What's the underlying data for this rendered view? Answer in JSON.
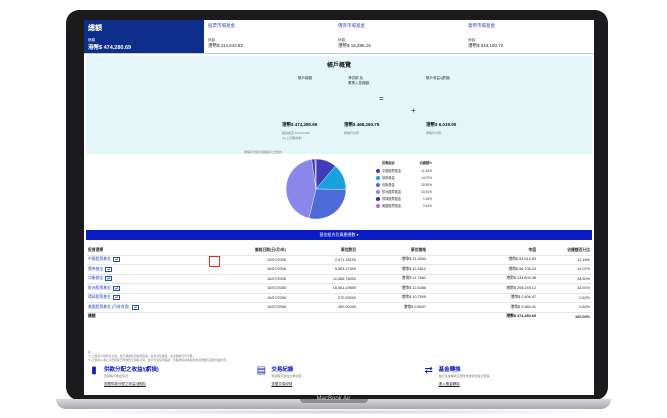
{
  "device": {
    "brand": "MacBook Air"
  },
  "summary": {
    "total": {
      "title": "總額",
      "label": "餘額",
      "value": "港幣$ 474,280.69"
    },
    "categories": [
      {
        "title": "股票市場基金",
        "label": "餘額",
        "value": "港幣$ 114,643.82"
      },
      {
        "title": "債券市場基金",
        "label": "餘額",
        "value": "港幣$ 16,286.15"
      },
      {
        "title": "貨幣市場基金",
        "label": "餘額",
        "value": "港幣$ 343,150.72"
      }
    ]
  },
  "overview": {
    "title": "帳戶概覽",
    "col1_label": "帳戶總額",
    "col2_label": "淨供款 及\n累積入息總額",
    "col3_label": "帳戶收益/(虧損)",
    "equals": "=",
    "plus": "+",
    "col1_value": "港幣$ 474,280.69",
    "col2_value": "港幣$ 468,260.79",
    "col3_value": "港幣$ 6,019.90",
    "col1_sub": "結餘截至 10/07/2006",
    "col1_sub2": "(以上日期為準)",
    "col2_sub": "按帳戶計算",
    "col3_sub": "按帳戶計算",
    "note": "按帳戶計算(包括帳戶之供款)"
  },
  "chart_data": {
    "type": "pie",
    "headers": [
      "投資組合",
      "佔總額%"
    ],
    "categories": [
      "中國股票基金",
      "債券基金",
      "均衡基金",
      "歐洲股票基金",
      "環球股票基金",
      "美國股票基金"
    ],
    "values": [
      11.18,
      14.07,
      28.5,
      43.91,
      1.63,
      0.62
    ],
    "colors": [
      "#3f3db8",
      "#18a0e0",
      "#4a6bd8",
      "#8b86ea",
      "#2f2fb0",
      "#c06ad8"
    ]
  },
  "bluebar": {
    "label": "基金組合及資產總數 ▾"
  },
  "table": {
    "headers": [
      "投資選擇",
      "價格日期(日/月/年)",
      "單位數目",
      "單位價格",
      "市值",
      "佔總額百分比"
    ],
    "rows": [
      {
        "name": "中國股票基金",
        "date": "10/07/2006",
        "units": "2,471.28100",
        "price": "港幣$ 21.4544",
        "value": "港幣$ 53,014.53",
        "pct": "11.18%"
      },
      {
        "name": "債券基金",
        "date": "10/07/2006",
        "units": "5,363.27300",
        "price": "港幣$ 12.4812",
        "value": "港幣$ 66,708.23",
        "pct": "14.07%"
      },
      {
        "name": "均衡基金",
        "date": "10/07/2006",
        "units": "11,466.76000",
        "price": "港幣$ 11.7661",
        "value": "港幣$ 134,809.38",
        "pct": "28.50%"
      },
      {
        "name": "歐洲股票基金",
        "date": "10/07/2006",
        "units": "16,561.19600",
        "price": "港幣$ 12.5486",
        "value": "港幣$ 208,245.12",
        "pct": "43.91%"
      },
      {
        "name": "環球股票基金",
        "date": "10/07/2006",
        "units": "270.33000",
        "price": "港幣$ 10.7509",
        "value": "港幣$ 2,906.47",
        "pct": "0.62%"
      },
      {
        "name": "美國股票基金 (可收費用)",
        "date": "10/07/2006",
        "units": "300.90200",
        "price": "港幣$ 9.8947",
        "value": "港幣$ 2,984.31",
        "pct": "0.62%"
      }
    ],
    "total_label": "總額",
    "total_value": "港幣$ 474,280.69",
    "total_pct": "100.00%"
  },
  "notes": {
    "line1": "註：",
    "line2": "*以上資料只供參考之用，並不構成任何投資建議。投資涉及風險，基金價格可升可跌。",
    "line3": "*以上資料以本公司於結算日所收到之資料計算，並不代表任何保證。有關詳情請參閱基金說明書及其他有關文件。"
  },
  "links": [
    {
      "title": "供款分配之收益/(虧損)",
      "desc": "查閱帳戶收益情況",
      "link": "查閱供款分配之收益/(虧損)"
    },
    {
      "title": "交易紀錄",
      "desc": "查閱帳戶過往交易紀錄",
      "link": "查閱交易紀錄"
    },
    {
      "title": "基金轉換",
      "desc": "進行基金轉換及更改未來供款投資選擇",
      "link": "進入基金轉換"
    }
  ]
}
